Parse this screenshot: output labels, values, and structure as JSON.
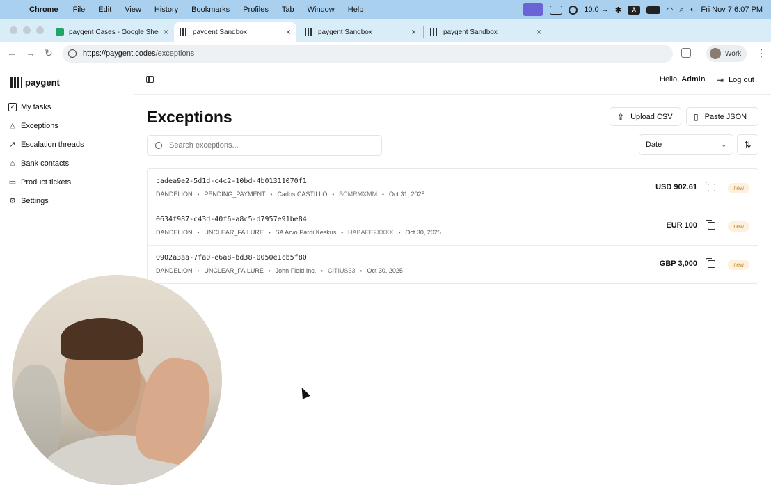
{
  "menubar": {
    "app": "Chrome",
    "items": [
      "File",
      "Edit",
      "View",
      "History",
      "Bookmarks",
      "Profiles",
      "Tab",
      "Window",
      "Help"
    ],
    "status_text": "10.0 →",
    "keyboard_badge": "A",
    "clock": "Fri Nov 7  6:07 PM"
  },
  "browser": {
    "tabs": [
      {
        "title": "paygent Cases - Google Sheets",
        "favicon": "sheets-icon"
      },
      {
        "title": "paygent Sandbox",
        "favicon": "paygent-icon",
        "active": true
      },
      {
        "title": "paygent Sandbox",
        "favicon": "paygent-icon"
      },
      {
        "title": "paygent Sandbox",
        "favicon": "paygent-icon"
      }
    ],
    "url_host": "https://paygent.codes",
    "url_path": "/exceptions",
    "profile": "Work"
  },
  "sidebar": {
    "brand": "paygent",
    "items": [
      {
        "label": "My tasks",
        "icon": "checkbox-icon"
      },
      {
        "label": "Exceptions",
        "icon": "warning-icon"
      },
      {
        "label": "Escalation threads",
        "icon": "trend-icon"
      },
      {
        "label": "Bank contacts",
        "icon": "bank-icon"
      },
      {
        "label": "Product tickets",
        "icon": "ticket-icon"
      },
      {
        "label": "Settings",
        "icon": "gear-icon"
      }
    ]
  },
  "header": {
    "greeting": "Hello,",
    "user": "Admin",
    "logout": "Log out"
  },
  "page": {
    "title": "Exceptions",
    "upload_csv": "Upload CSV",
    "paste_json": "Paste JSON",
    "search_placeholder": "Search exceptions...",
    "sort_select": "Date"
  },
  "exceptions": [
    {
      "id": "cadea9e2-5d1d-c4c2-10bd-4b01311070f1",
      "source": "DANDELION",
      "status": "PENDING_PAYMENT",
      "party": "Carlos CASTILLO",
      "bic": "BCMRMXMM",
      "date": "Oct 31, 2025",
      "amount": "USD 902.61",
      "badge": "new"
    },
    {
      "id": "0634f987-c43d-40f6-a8c5-d7957e91be84",
      "source": "DANDELION",
      "status": "UNCLEAR_FAILURE",
      "party": "SA Arvo Pardi Keskus",
      "bic": "HABAEE2XXXX",
      "date": "Oct 30, 2025",
      "amount": "EUR 100",
      "badge": "new"
    },
    {
      "id": "0902a3aa-7fa0-e6a8-bd38-0050e1cb5f80",
      "source": "DANDELION",
      "status": "UNCLEAR_FAILURE",
      "party": "John Field Inc.",
      "bic": "CITIUS33",
      "date": "Oct 30, 2025",
      "amount": "GBP 3,000",
      "badge": "new"
    }
  ],
  "colors": {
    "menubar": "#a9d0ee",
    "tabstrip": "#d9edf9",
    "badge_bg": "#fdf1dd",
    "badge_text": "#c98a2b"
  }
}
